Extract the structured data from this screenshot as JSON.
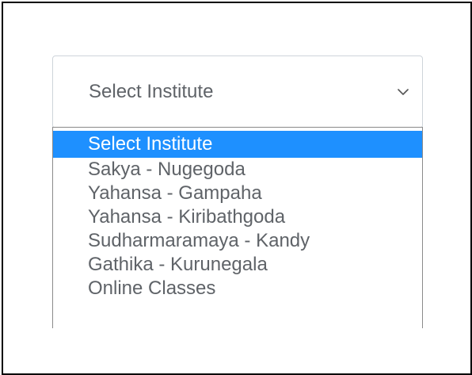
{
  "select": {
    "value": "Select Institute"
  },
  "icons": {
    "chevron": "chevron-down-icon"
  },
  "colors": {
    "highlight": "#1e90ff",
    "text": "#5f6368",
    "border": "#ced4da"
  },
  "dropdown": {
    "options": [
      {
        "label": "Select Institute",
        "selected": true
      },
      {
        "label": "Sakya - Nugegoda",
        "selected": false
      },
      {
        "label": "Yahansa - Gampaha",
        "selected": false
      },
      {
        "label": "Yahansa - Kiribathgoda",
        "selected": false
      },
      {
        "label": "Sudharmaramaya - Kandy",
        "selected": false
      },
      {
        "label": "Gathika - Kurunegala",
        "selected": false
      },
      {
        "label": "Online Classes",
        "selected": false
      }
    ]
  }
}
